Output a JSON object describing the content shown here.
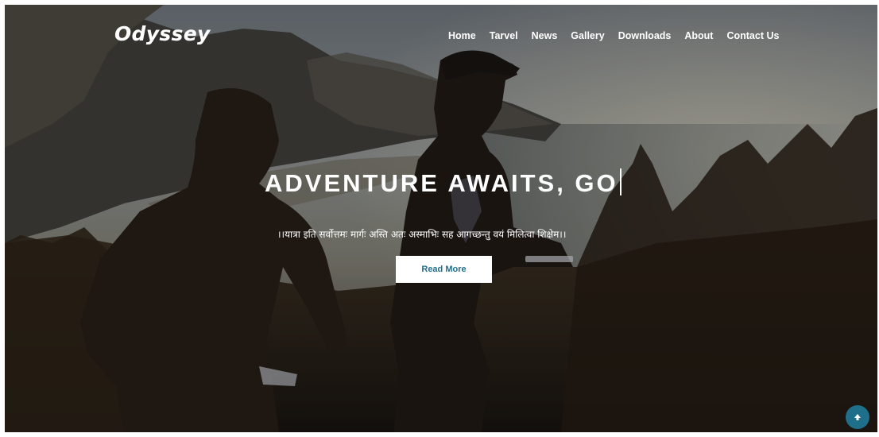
{
  "brand": {
    "logo_text": "Odyssey"
  },
  "nav": {
    "items": [
      {
        "label": "Home"
      },
      {
        "label": "Tarvel"
      },
      {
        "label": "News"
      },
      {
        "label": "Gallery"
      },
      {
        "label": "Downloads"
      },
      {
        "label": "About"
      },
      {
        "label": "Contact Us"
      }
    ]
  },
  "hero": {
    "headline": "ADVENTURE AWAITS, GO",
    "tagline": "।।यात्रा इति सर्वोत्तमः मार्गः अस्ति अतः अस्माभिः सह आगच्छन्तु वयं मिलित्वा शिक्षेम।।",
    "cta_label": "Read More"
  },
  "colors": {
    "accent": "#1f6f8b",
    "text_on_hero": "#ffffff"
  },
  "icons": {
    "scroll_top": "arrow-up-icon"
  }
}
